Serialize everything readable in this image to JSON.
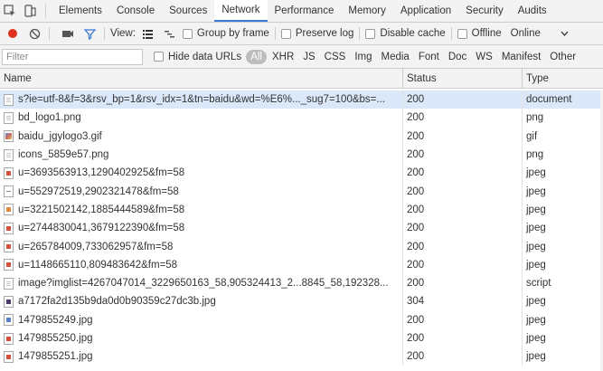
{
  "tabs": [
    {
      "label": "Elements",
      "active": false
    },
    {
      "label": "Console",
      "active": false
    },
    {
      "label": "Sources",
      "active": false
    },
    {
      "label": "Network",
      "active": true
    },
    {
      "label": "Performance",
      "active": false
    },
    {
      "label": "Memory",
      "active": false
    },
    {
      "label": "Application",
      "active": false
    },
    {
      "label": "Security",
      "active": false
    },
    {
      "label": "Audits",
      "active": false
    }
  ],
  "toolbar": {
    "view_label": "View:",
    "group_by_frame": "Group by frame",
    "preserve_log": "Preserve log",
    "disable_cache": "Disable cache",
    "offline": "Offline",
    "throttle": "Online"
  },
  "filter": {
    "placeholder": "Filter",
    "hide_data_urls": "Hide data URLs",
    "types": [
      "All",
      "XHR",
      "JS",
      "CSS",
      "Img",
      "Media",
      "Font",
      "Doc",
      "WS",
      "Manifest",
      "Other"
    ]
  },
  "columns": {
    "name": "Name",
    "status": "Status",
    "type": "Type"
  },
  "rows": [
    {
      "name": "s?ie=utf-8&f=3&rsv_bp=1&rsv_idx=1&tn=baidu&wd=%E6%..._sug7=100&bs=...",
      "status": "200",
      "type": "document",
      "icon": "doc"
    },
    {
      "name": "bd_logo1.png",
      "status": "200",
      "type": "png",
      "icon": "doc"
    },
    {
      "name": "baidu_jgylogo3.gif",
      "status": "200",
      "type": "gif",
      "icon": "imgmulti"
    },
    {
      "name": "icons_5859e57.png",
      "status": "200",
      "type": "png",
      "icon": "doc"
    },
    {
      "name": "u=3693563913,1290402925&fm=58",
      "status": "200",
      "type": "jpeg",
      "icon": "img"
    },
    {
      "name": "u=552972519,2902321478&fm=58",
      "status": "200",
      "type": "jpeg",
      "icon": "imggray"
    },
    {
      "name": "u=3221502142,1885444589&fm=58",
      "status": "200",
      "type": "jpeg",
      "icon": "imgorange"
    },
    {
      "name": "u=2744830041,3679122390&fm=58",
      "status": "200",
      "type": "jpeg",
      "icon": "img"
    },
    {
      "name": "u=265784009,733062957&fm=58",
      "status": "200",
      "type": "jpeg",
      "icon": "img"
    },
    {
      "name": "u=1148665110,809483642&fm=58",
      "status": "200",
      "type": "jpeg",
      "icon": "img"
    },
    {
      "name": "image?imglist=4267047014_3229650163_58,905324413_2...8845_58,192328...",
      "status": "200",
      "type": "script",
      "icon": "doc"
    },
    {
      "name": "a7172fa2d135b9da0d0b90359c27dc3b.jpg",
      "status": "304",
      "type": "jpeg",
      "icon": "imgdark"
    },
    {
      "name": "1479855249.jpg",
      "status": "200",
      "type": "jpeg",
      "icon": "imgblue"
    },
    {
      "name": "1479855250.jpg",
      "status": "200",
      "type": "jpeg",
      "icon": "img"
    },
    {
      "name": "1479855251.jpg",
      "status": "200",
      "type": "jpeg",
      "icon": "img"
    }
  ],
  "colors": {
    "record": "#e0301e",
    "filter_icon": "#3879d9",
    "selected_row": "#dbe8f9"
  }
}
